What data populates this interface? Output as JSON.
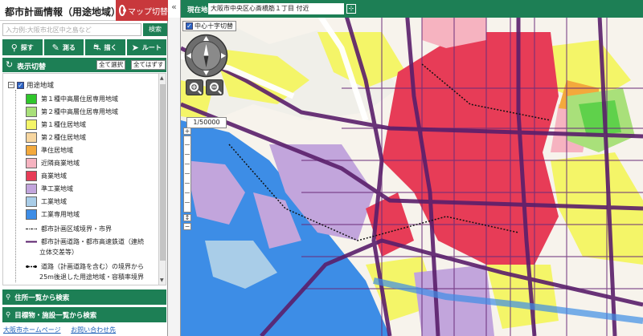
{
  "app": {
    "title": "都市計画情報（用途地域）",
    "map_switch_label": "マップ切替"
  },
  "search": {
    "placeholder": "入力例:大阪市北区中之島など",
    "button_label": "検索"
  },
  "tools": [
    {
      "label": "探す",
      "icon": "magnifier-icon"
    },
    {
      "label": "測る",
      "icon": "ruler-icon"
    },
    {
      "label": "描く",
      "icon": "car-icon"
    },
    {
      "label": "ルート",
      "icon": "route-icon"
    }
  ],
  "display_toggle": {
    "label": "表示切替",
    "select_all_label": "全て選択",
    "deselect_all_label": "全てはずす"
  },
  "legend": {
    "root_label": "用途地域",
    "items": [
      {
        "label": "第１種中高層住居専用地域",
        "color": "#2fc62b"
      },
      {
        "label": "第２種中高層住居専用地域",
        "color": "#a9e07a"
      },
      {
        "label": "第１種住居地域",
        "color": "#f4f568"
      },
      {
        "label": "第２種住居地域",
        "color": "#f7d6a0"
      },
      {
        "label": "準住居地域",
        "color": "#f3a93c"
      },
      {
        "label": "近隣商業地域",
        "color": "#f6b3c0"
      },
      {
        "label": "商業地域",
        "color": "#e73c57"
      },
      {
        "label": "準工業地域",
        "color": "#c2a5dc"
      },
      {
        "label": "工業地域",
        "color": "#a9cde8"
      },
      {
        "label": "工業専用地域",
        "color": "#3d8de6"
      }
    ],
    "line_items": [
      {
        "label": "都市計画区域境界・市界"
      },
      {
        "label": "都市計画道路・都市高速鉄道（連続",
        "label2": "立体交差等）"
      },
      {
        "label": "道路（計画道路を含む）の境界から",
        "label2": "25m後退した用途地域・容積率境界"
      }
    ]
  },
  "accordions": [
    {
      "label": "住所一覧から検索"
    },
    {
      "label": "目標物・施設一覧から検索"
    }
  ],
  "footer_links": [
    {
      "label": "大阪市ホームページ"
    },
    {
      "label": "お問い合わせ先"
    }
  ],
  "location": {
    "label": "現在地",
    "value": "大阪市中央区心斎橋筋１丁目 付近"
  },
  "map_controls": {
    "crosshair_label": "中心十字切替",
    "scale": "1/50000",
    "north_label": "N"
  },
  "colors": {
    "accent_green": "#1d7f55",
    "map_switch_red": "#c8383c",
    "road_purple": "#5a1f6b"
  }
}
